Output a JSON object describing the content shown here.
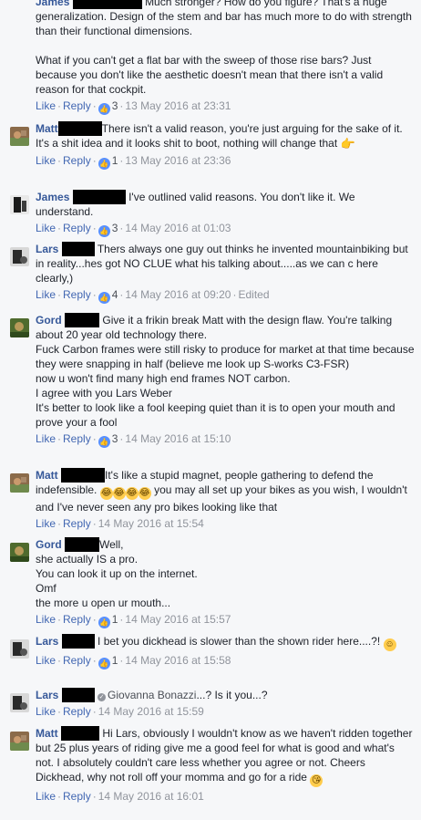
{
  "actions": {
    "like": "Like",
    "reply": "Reply",
    "separator": "·",
    "edited": "Edited"
  },
  "comments": [
    {
      "author": "James",
      "text": "Much stronger? How do you figure? That's a huge generalization. Design of the stem and bar has much more to do with strength than their functional dimensions.\n\nWhat if you can't get a flat bar with the sweep of those rise bars? Just because you don't like the aesthetic doesn't mean that there isn't a valid reason for that cockpit.",
      "likes": "3",
      "time": "13 May 2016 at 23:31"
    },
    {
      "author": "Matt",
      "text": "There isn't a valid reason, you're just arguing for the sake of it. It's a shit idea and it looks shit to boot, nothing will change that",
      "likes": "1",
      "time": "13 May 2016 at 23:36"
    },
    {
      "author": "James",
      "text": "I've outlined valid reasons. You don't like it. We understand.",
      "likes": "3",
      "time": "14 May 2016 at 01:03"
    },
    {
      "author": "Lars",
      "text": "Thers always one guy out thinks he invented mountainbiking but in reality...hes got NO CLUE what his talking about.....as we can c here clearly,)",
      "likes": "4",
      "time": "14 May 2016 at 09:20"
    },
    {
      "author": "Gord",
      "text": "Give it a frikin break Matt with the design flaw. You're talking about 20 year old technology there.\nFuck Carbon frames were still risky to produce for market at that time because they were snapping in half (believe me look up S-works C3-FSR)\nnow u won't find many high end frames NOT carbon.\nI agree with you Lars Weber\nIt's better to look like a fool keeping quiet than it is to open your mouth and prove your a fool",
      "likes": "3",
      "time": "14 May 2016 at 15:10"
    },
    {
      "author": "Matt",
      "text_a": "It's like a stupid magnet, people gathering to defend the indefensible.",
      "text_b": "you may all set up your bikes as you wish, I wouldn't and I've never seen any pro bikes looking like that",
      "time": "14 May 2016 at 15:54"
    },
    {
      "author": "Gord",
      "text": "Well,\nshe actually IS a pro.\nYou can look it up on the internet.\nOmf\nthe more u open ur mouth...",
      "likes": "1",
      "time": "14 May 2016 at 15:57"
    },
    {
      "author": "Lars",
      "text": "I bet you dickhead is slower than the shown rider here....?!",
      "likes": "1",
      "time": "14 May 2016 at 15:58"
    },
    {
      "author": "Lars",
      "mention": "Giovanna Bonazzi",
      "text": "...? Is it you...?",
      "time": "14 May 2016 at 15:59"
    },
    {
      "author": "Matt",
      "text": "Hi Lars, obviously I wouldn't know as we haven't ridden together but 25 plus years of riding give me a good feel for what is good and what's not. I absolutely couldn't care less whether you agree or not. Cheers Dickhead, why not roll off your momma and go for a ride",
      "time": "14 May 2016 at 16:01"
    }
  ]
}
